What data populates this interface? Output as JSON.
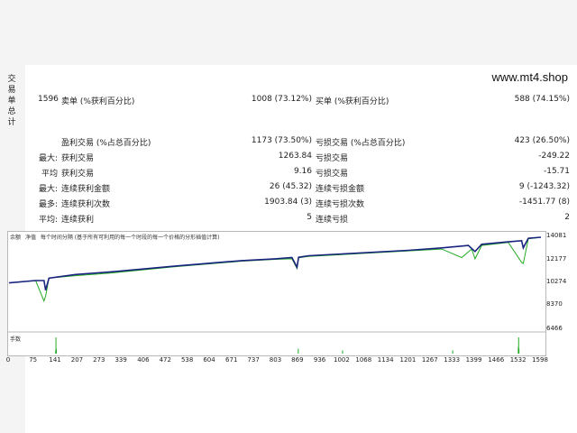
{
  "site": "www.mt4.shop",
  "side_label": [
    "交",
    "易",
    "单",
    "总",
    "计"
  ],
  "stats": {
    "row1": {
      "count": "1596",
      "sell_label": "卖单 (%获利百分比)",
      "sell_value": "1008 (73.12%)",
      "buy_label": "买单 (%获利百分比)",
      "buy_value": "588 (74.15%)"
    },
    "row2": {
      "win_label": "盈利交易 (%占总百分比)",
      "win_value": "1173 (73.50%)",
      "loss_label": "亏损交易 (%占总百分比)",
      "loss_value": "423 (26.50%)"
    },
    "row3": {
      "prefix": "最大:",
      "win_label": "获利交易",
      "win_value": "1263.84",
      "loss_label": "亏损交易",
      "loss_value": "-249.22"
    },
    "row4": {
      "prefix": "平均",
      "win_label": "获利交易",
      "win_value": "9.16",
      "loss_label": "亏损交易",
      "loss_value": "-15.71"
    },
    "row5": {
      "prefix": "最大:",
      "win_label": "连续获利金额",
      "win_value": "26 (45.32)",
      "loss_label": "连续亏损金额",
      "loss_value": "9 (-1243.32)"
    },
    "row6": {
      "prefix": "最多:",
      "win_label": "连续获利次数",
      "win_value": "1903.84 (3)",
      "loss_label": "连续亏损次数",
      "loss_value": "-1451.77 (8)"
    },
    "row7": {
      "prefix": "平均:",
      "win_label": "连续获利",
      "win_value": "5",
      "loss_label": "连续亏损",
      "loss_value": "2"
    }
  },
  "chart": {
    "legend": [
      "余额",
      "净值",
      "每个时间分隔 (基于所有可利用的每一个时段的每一个价格的分形插值计算)"
    ],
    "lot_label": "手数",
    "colors": {
      "balance": "#1a237e",
      "equity": "#22aa22",
      "lots": "#22aa22"
    }
  },
  "chart_data": {
    "type": "line",
    "y_ticks": [
      "14081",
      "12177",
      "10274",
      "8370",
      "6466"
    ],
    "x_ticks": [
      "0",
      "75",
      "141",
      "207",
      "273",
      "339",
      "406",
      "472",
      "538",
      "604",
      "671",
      "737",
      "803",
      "869",
      "936",
      "1002",
      "1068",
      "1134",
      "1201",
      "1267",
      "1333",
      "1399",
      "1466",
      "1532",
      "1598"
    ],
    "ylim": [
      6466,
      14081
    ],
    "series": [
      {
        "name": "余额",
        "x": [
          0,
          80,
          105,
          110,
          120,
          200,
          300,
          500,
          700,
          800,
          850,
          865,
          870,
          900,
          1000,
          1200,
          1300,
          1380,
          1400,
          1420,
          1500,
          1540,
          1545,
          1560,
          1598
        ],
        "values": [
          10300,
          10500,
          10500,
          9700,
          10700,
          11000,
          11200,
          11700,
          12150,
          12300,
          12400,
          11600,
          12420,
          12550,
          12700,
          13000,
          13200,
          13400,
          12900,
          13500,
          13700,
          13800,
          13200,
          14000,
          14081
        ]
      },
      {
        "name": "净值",
        "x": [
          0,
          80,
          105,
          110,
          120,
          200,
          300,
          500,
          700,
          800,
          850,
          865,
          870,
          900,
          1000,
          1200,
          1300,
          1360,
          1390,
          1400,
          1420,
          1500,
          1540,
          1545,
          1560,
          1598
        ],
        "values": [
          10300,
          10500,
          8800,
          9200,
          10700,
          10900,
          11100,
          11650,
          12100,
          12250,
          12300,
          11500,
          12380,
          12500,
          12650,
          12950,
          13100,
          12400,
          13100,
          12300,
          13400,
          13650,
          12000,
          11900,
          13950,
          14081
        ]
      }
    ],
    "lots": {
      "x": [
        140,
        141,
        142,
        869,
        1002,
        1333,
        1530,
        1531,
        1532
      ],
      "values": [
        0.2,
        1.0,
        0.3,
        0.3,
        0.2,
        0.2,
        0.4,
        1.0,
        0.3
      ]
    }
  }
}
